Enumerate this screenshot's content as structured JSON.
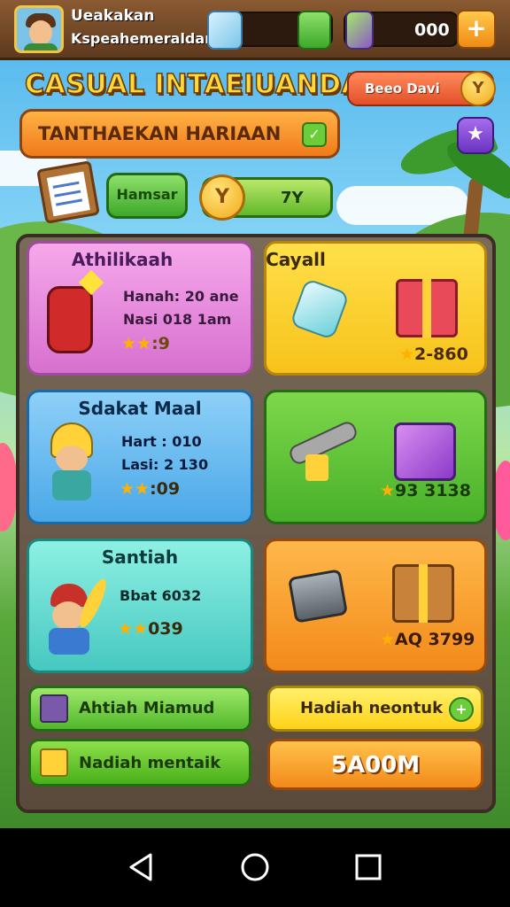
{
  "player": {
    "name": "Ueakakan",
    "subtitle": "Kspeahemeraldan"
  },
  "resources": [
    {
      "icon": "gem-icon",
      "value": ""
    },
    {
      "icon": "bolt-icon",
      "value": "000"
    }
  ],
  "header": {
    "title": "CASUAL INTAEIUANDASI",
    "bonus_label": "Beeo Davi",
    "bonus_coin": "Y"
  },
  "banner": {
    "label": "TANTHAEKAN HARIAAN"
  },
  "quick": {
    "kamsar_label": "Hamsar",
    "coin_symbol": "Y",
    "coin_value": "7Y"
  },
  "cards": [
    {
      "title": "Athilikaah",
      "line1": "Hanah: 20 ane",
      "line2": "Nasi 018 1am",
      "rating": ":9"
    },
    {
      "title": "Cayall",
      "price": "2-860"
    },
    {
      "title": "Sdakat Maal",
      "line1": "Hart : 010",
      "line2": "Lasi: 2 130",
      "rating": ":09"
    },
    {
      "title": "",
      "price": "93 3138"
    },
    {
      "title": "Santiah",
      "line1": "Bbat 6032",
      "line2": "",
      "rating": "039"
    },
    {
      "title": "",
      "price": "AQ 3799"
    }
  ],
  "bottom": {
    "btn1": "Ahtiah Miamud",
    "btn2": "Nadiah mentaik",
    "reward_label": "Hadiah neontuk",
    "reward_value": "5A00M"
  },
  "colors": {
    "accent": "#f08a14",
    "brand_green": "#3da82a",
    "title_yellow": "#ffd83a"
  }
}
